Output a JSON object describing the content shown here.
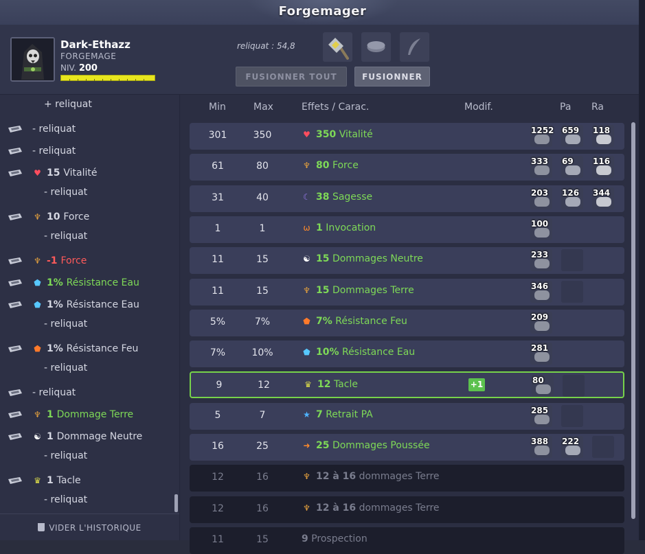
{
  "window": {
    "title": "Forgemager"
  },
  "character": {
    "name": "Dark-Ethazz",
    "job": "FORGEMAGE",
    "level_label": "NIV.",
    "level": "200"
  },
  "reliquat_text": "reliquat : 54,8",
  "slots": [
    {
      "icon": "hammer-icon"
    },
    {
      "icon": "ring-slot-icon"
    },
    {
      "icon": "feather-icon"
    }
  ],
  "buttons": {
    "fuse_all": "FUSIONNER TOUT",
    "fuse": "FUSIONNER"
  },
  "history": [
    {
      "icon": "none",
      "amount": "",
      "text": "+ reliquat",
      "style": "plain",
      "indent": true
    },
    {
      "icon": "rune-icon",
      "amount": "",
      "text": "- reliquat",
      "style": "plain",
      "indent": false
    },
    {
      "icon": "rune-icon",
      "amount": "",
      "text": "- reliquat",
      "style": "plain",
      "indent": false
    },
    {
      "icon": "rune-icon",
      "eff_icon": "heart-icon",
      "amount": "15",
      "text": "Vitalité",
      "style": "plain",
      "indent": false
    },
    {
      "icon": "none",
      "amount": "",
      "text": "- reliquat",
      "style": "plain",
      "indent": true
    },
    {
      "icon": "rune-icon",
      "eff_icon": "force-icon",
      "amount": "10",
      "text": "Force",
      "style": "plain",
      "indent": false
    },
    {
      "icon": "none",
      "amount": "",
      "text": "- reliquat",
      "style": "plain",
      "indent": true
    },
    {
      "icon": "rune-icon",
      "eff_icon": "force-icon",
      "amount": "-1",
      "text": "Force",
      "style": "red",
      "indent": false
    },
    {
      "icon": "rune-icon",
      "eff_icon": "water-shield-icon",
      "amount": "1%",
      "text": "Résistance Eau",
      "style": "green",
      "indent": false
    },
    {
      "icon": "rune-icon",
      "eff_icon": "water-shield-icon",
      "amount": "1%",
      "text": "Résistance Eau",
      "style": "plain",
      "indent": false
    },
    {
      "icon": "none",
      "amount": "",
      "text": "- reliquat",
      "style": "plain",
      "indent": true
    },
    {
      "icon": "rune-icon",
      "eff_icon": "fire-shield-icon",
      "amount": "1%",
      "text": "Résistance Feu",
      "style": "plain",
      "indent": false
    },
    {
      "icon": "none",
      "amount": "",
      "text": "- reliquat",
      "style": "plain",
      "indent": true
    },
    {
      "icon": "rune-icon",
      "amount": "",
      "text": "- reliquat",
      "style": "plain",
      "indent": false
    },
    {
      "icon": "rune-icon",
      "eff_icon": "force-icon",
      "amount": "1",
      "text": "Dommage Terre",
      "style": "green",
      "indent": false
    },
    {
      "icon": "rune-icon",
      "eff_icon": "neutral-icon",
      "amount": "1",
      "text": "Dommage Neutre",
      "style": "plain",
      "indent": false
    },
    {
      "icon": "none",
      "amount": "",
      "text": "- reliquat",
      "style": "plain",
      "indent": true
    },
    {
      "icon": "rune-icon",
      "eff_icon": "tackle-icon",
      "amount": "1",
      "text": "Tacle",
      "style": "plain",
      "indent": false
    },
    {
      "icon": "none",
      "amount": "",
      "text": "- reliquat",
      "style": "plain",
      "indent": true
    }
  ],
  "clear_history": "VIDER L'HISTORIQUE",
  "columns": {
    "min": "Min",
    "max": "Max",
    "effects": "Effets / Carac.",
    "modif": "Modif.",
    "pa": "Pa",
    "ra": "Ra"
  },
  "rows": [
    {
      "min": "301",
      "max": "350",
      "eff_icon": "heart-icon",
      "amount": "350",
      "name": "Vitalité",
      "modif": "",
      "runes": [
        "1252",
        "659",
        "118"
      ],
      "empties": 0,
      "state": "normal"
    },
    {
      "min": "61",
      "max": "80",
      "eff_icon": "force-icon",
      "amount": "80",
      "name": "Force",
      "modif": "",
      "runes": [
        "333",
        "69",
        "116"
      ],
      "empties": 0,
      "state": "normal"
    },
    {
      "min": "31",
      "max": "40",
      "eff_icon": "wisdom-icon",
      "amount": "38",
      "name": "Sagesse",
      "modif": "",
      "runes": [
        "203",
        "126",
        "344"
      ],
      "empties": 0,
      "state": "normal"
    },
    {
      "min": "1",
      "max": "1",
      "eff_icon": "summon-icon",
      "amount": "1",
      "name": "Invocation",
      "modif": "",
      "runes": [
        "100"
      ],
      "empties": 0,
      "state": "normal"
    },
    {
      "min": "11",
      "max": "15",
      "eff_icon": "neutral-icon",
      "amount": "15",
      "name": "Dommages Neutre",
      "modif": "",
      "runes": [
        "233"
      ],
      "empties": 1,
      "state": "normal"
    },
    {
      "min": "11",
      "max": "15",
      "eff_icon": "force-icon",
      "amount": "15",
      "name": "Dommages Terre",
      "modif": "",
      "runes": [
        "346"
      ],
      "empties": 1,
      "state": "normal"
    },
    {
      "min": "5%",
      "max": "7%",
      "eff_icon": "fire-shield-icon",
      "amount": "7%",
      "name": "Résistance Feu",
      "modif": "",
      "runes": [
        "209"
      ],
      "empties": 0,
      "state": "normal"
    },
    {
      "min": "7%",
      "max": "10%",
      "eff_icon": "water-shield-icon",
      "amount": "10%",
      "name": "Résistance Eau",
      "modif": "",
      "runes": [
        "281"
      ],
      "empties": 0,
      "state": "normal"
    },
    {
      "min": "9",
      "max": "12",
      "eff_icon": "tackle-icon",
      "amount": "12",
      "name": "Tacle",
      "modif": "+1",
      "runes": [
        "80"
      ],
      "empties": 1,
      "state": "highlight"
    },
    {
      "min": "5",
      "max": "7",
      "eff_icon": "ap-reduction-icon",
      "amount": "7",
      "name": "Retrait PA",
      "modif": "",
      "runes": [
        "285"
      ],
      "empties": 1,
      "state": "normal"
    },
    {
      "min": "16",
      "max": "25",
      "eff_icon": "push-icon",
      "amount": "25",
      "name": "Dommages Poussée",
      "modif": "",
      "runes": [
        "388",
        "222"
      ],
      "empties": 1,
      "state": "normal"
    },
    {
      "min": "12",
      "max": "16",
      "eff_icon": "force-icon",
      "amount": "12 à 16",
      "name": "dommages Terre",
      "modif": "",
      "runes": [],
      "empties": 0,
      "state": "dim"
    },
    {
      "min": "12",
      "max": "16",
      "eff_icon": "force-icon",
      "amount": "12 à 16",
      "name": "dommages Terre",
      "modif": "",
      "runes": [],
      "empties": 0,
      "state": "dim"
    },
    {
      "min": "11",
      "max": "15",
      "eff_icon": "",
      "amount": "9",
      "name": "Prospection",
      "modif": "",
      "runes": [],
      "empties": 0,
      "state": "dim"
    }
  ],
  "colors": {
    "green": "#7ed957",
    "red": "#ff5a5a",
    "row_bg": "#3a3e5a",
    "highlight_border": "#77d34a",
    "xp_bar": "#e8e61e"
  }
}
